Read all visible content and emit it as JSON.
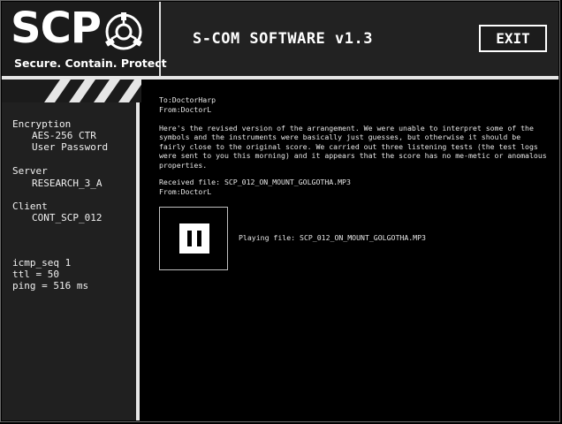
{
  "header": {
    "logo_text": "SCP",
    "tagline": "Secure. Contain. Protect",
    "app_title": "S-COM SOFTWARE v1.3",
    "exit_label": "EXIT"
  },
  "sidebar": {
    "encryption_label": "Encryption",
    "encryption_values": [
      "AES-256 CTR",
      "User Password"
    ],
    "server_label": "Server",
    "server_value": "RESEARCH_3_A",
    "client_label": "Client",
    "client_value": "CONT_SCP_012",
    "stats": [
      "icmp_seq 1",
      "ttl = 50",
      "ping = 516 ms"
    ]
  },
  "message": {
    "to": "To:DoctorHarp",
    "from": "From:DoctorL",
    "body": "Here's the revised version of the arrangement. We were unable to interpret some of the symbols and the instruments were basically just guesses, but otherwise it should be fairly close to the original score. We carried out three listening tests (the test logs were sent to you this morning) and it appears that the score has no me-metic or anomalous properties.",
    "received_file": "Received file: SCP_012_ON_MOUNT_GOLGOTHA.MP3",
    "received_from": "From:DoctorL"
  },
  "player": {
    "status_text": "Playing file: SCP_012_ON_MOUNT_GOLGOTHA.MP3",
    "icon": "pause-icon"
  },
  "colors": {
    "background": "#000000",
    "panel": "#202020",
    "accent": "#e6e6e6"
  }
}
